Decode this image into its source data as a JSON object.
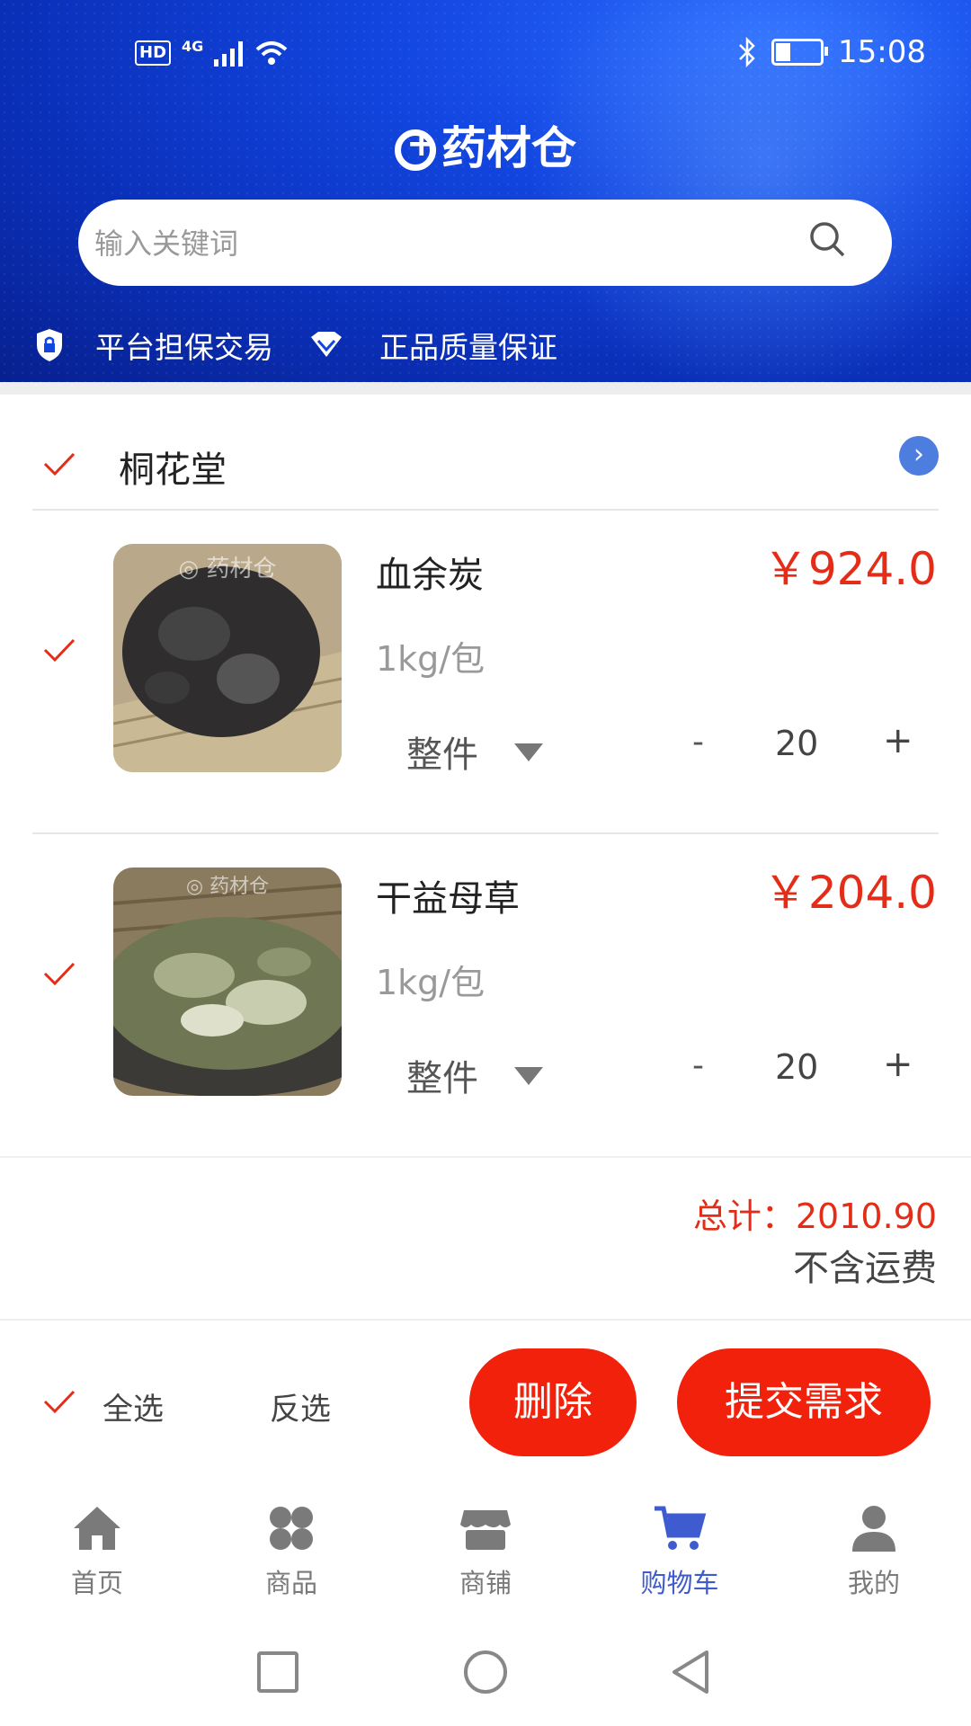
{
  "status_bar": {
    "network": "HD",
    "signal": "4G",
    "time": "15:08"
  },
  "header": {
    "app_name": "药材仓",
    "search_placeholder": "输入关键词",
    "guarantees": [
      "平台担保交易",
      "正品质量保证"
    ]
  },
  "store": {
    "name": "桐花堂"
  },
  "items": [
    {
      "name": "血余炭",
      "spec": "1kg/包",
      "price": "￥924.0",
      "unit": "整件",
      "qty": "20",
      "minus": "-",
      "plus": "+"
    },
    {
      "name": "干益母草",
      "spec": "1kg/包",
      "price": "￥204.0",
      "unit": "整件",
      "qty": "20",
      "minus": "-",
      "plus": "+"
    }
  ],
  "summary": {
    "total": "总计：2010.90",
    "note": "不含运费"
  },
  "actions": {
    "select_all": "全选",
    "invert": "反选",
    "delete": "删除",
    "submit": "提交需求"
  },
  "tabs": [
    {
      "label": "首页",
      "icon": "home-icon"
    },
    {
      "label": "商品",
      "icon": "grid-icon"
    },
    {
      "label": "商铺",
      "icon": "shop-icon"
    },
    {
      "label": "购物车",
      "icon": "cart-icon",
      "active": true
    },
    {
      "label": "我的",
      "icon": "user-icon"
    }
  ],
  "colors": {
    "accent": "#f2210b",
    "price": "#e32d19",
    "header": "#1246e0",
    "tab_active": "#3f5bd0"
  }
}
